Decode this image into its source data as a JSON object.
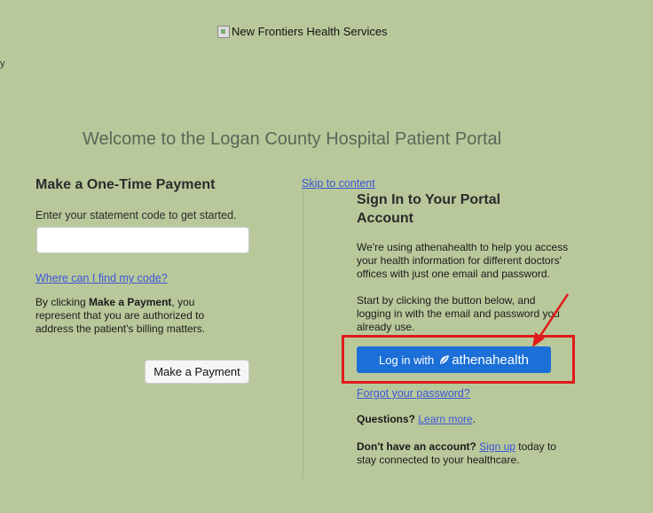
{
  "header": {
    "logo_alt": "New Frontiers Health Services",
    "edge_mark": "y"
  },
  "welcome": "Welcome to the Logan County Hospital Patient Portal",
  "payment": {
    "title": "Make a One-Time Payment",
    "subtitle": "Enter your statement code to get started.",
    "input_value": "",
    "find_code_link": "Where can I find my code?",
    "note_prefix": "By clicking ",
    "note_bold": "Make a Payment",
    "note_suffix": ", you represent that you are authorized to address the patient's billing matters.",
    "button_label": "Make a Payment"
  },
  "signin": {
    "skip_link": "Skip to content",
    "title": "Sign In to Your Portal Account",
    "para1": "We're using athenahealth to help you access your health information for different doctors' offices with just one email and password.",
    "para2": "Start by clicking the button below, and logging in with the email and password you already use.",
    "login_prefix": "Log in with",
    "login_brand": "athenahealth",
    "forgot_link": "Forgot your password?",
    "questions_label": "Questions?",
    "learn_more_link": "Learn more",
    "questions_end": ".",
    "no_account_label": "Don't have an account?",
    "signup_link": "Sign up",
    "no_account_suffix": " today to stay connected to your healthcare."
  },
  "colors": {
    "background": "#b9c89b",
    "primary_button": "#1b6fd6",
    "highlight": "#e01b1b",
    "link": "#3a56d6"
  }
}
